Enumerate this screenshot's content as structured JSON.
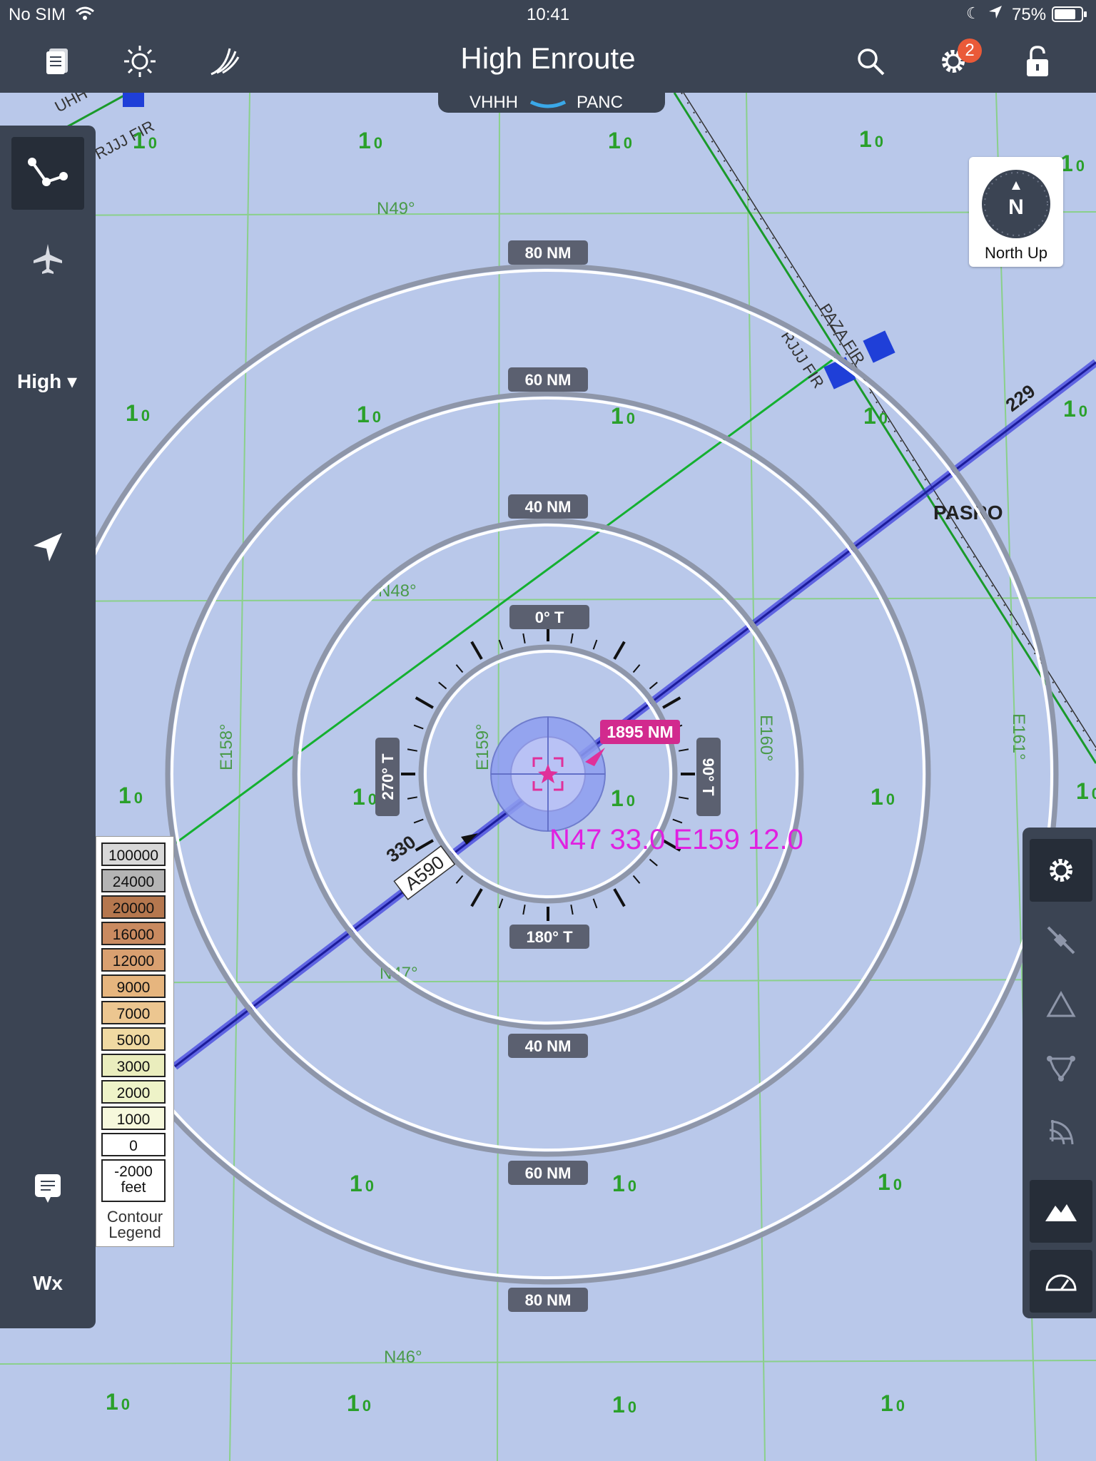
{
  "status_bar": {
    "carrier": "No SIM",
    "time": "10:41",
    "battery": "75%"
  },
  "toolbar": {
    "title": "High Enroute",
    "notifications_badge": "2",
    "icons": [
      "documents-icon",
      "brightness-icon",
      "layers-icon",
      "search-icon",
      "gear-icon",
      "lock-icon"
    ]
  },
  "route": {
    "origin": "VHHH",
    "destination": "PANC"
  },
  "sidebar": {
    "chart_type": "High ▾",
    "wx_label": "Wx"
  },
  "north_up": {
    "letter": "N",
    "label": "North Up"
  },
  "range_rings": {
    "inner": "40 NM",
    "middle": "60 NM",
    "outer": "80 NM"
  },
  "compass": {
    "north": "0° T",
    "east": "90° T",
    "south": "180° T",
    "west": "270° T"
  },
  "ownship": {
    "distance": "1895 NM",
    "position": "N47 33.0 E159 12.0"
  },
  "chart": {
    "latitudes": [
      "N49°",
      "N48°",
      "N47°",
      "N46°"
    ],
    "longitudes": [
      "E158°",
      "E159°",
      "E160°",
      "E161°"
    ],
    "airway": "A590",
    "airway_course_left": "330",
    "airway_course_right": "229",
    "fix": "PASRO",
    "fir_labels": [
      "PAZA FIR",
      "RJJJ FIR",
      "RJJJ FIR",
      "UHH"
    ],
    "grid_mora": {
      "big": "1",
      "small": "0"
    }
  },
  "contour_legend": {
    "title_line1": "Contour",
    "title_line2": "Legend",
    "unit": "feet",
    "levels": [
      {
        "label": "100000",
        "color": "#d8d8d8"
      },
      {
        "label": "24000",
        "color": "#b4b4b4"
      },
      {
        "label": "20000",
        "color": "#b5774e"
      },
      {
        "label": "16000",
        "color": "#c98a60"
      },
      {
        "label": "12000",
        "color": "#d9a070"
      },
      {
        "label": "9000",
        "color": "#e6b57e"
      },
      {
        "label": "7000",
        "color": "#ecc690"
      },
      {
        "label": "5000",
        "color": "#f0d9a2"
      },
      {
        "label": "3000",
        "color": "#eaedbd"
      },
      {
        "label": "2000",
        "color": "#eef3c8"
      },
      {
        "label": "1000",
        "color": "#f6f8dc"
      },
      {
        "label": "0",
        "color": "#ffffff"
      },
      {
        "label": "-2000",
        "color": "#ffffff"
      }
    ]
  }
}
